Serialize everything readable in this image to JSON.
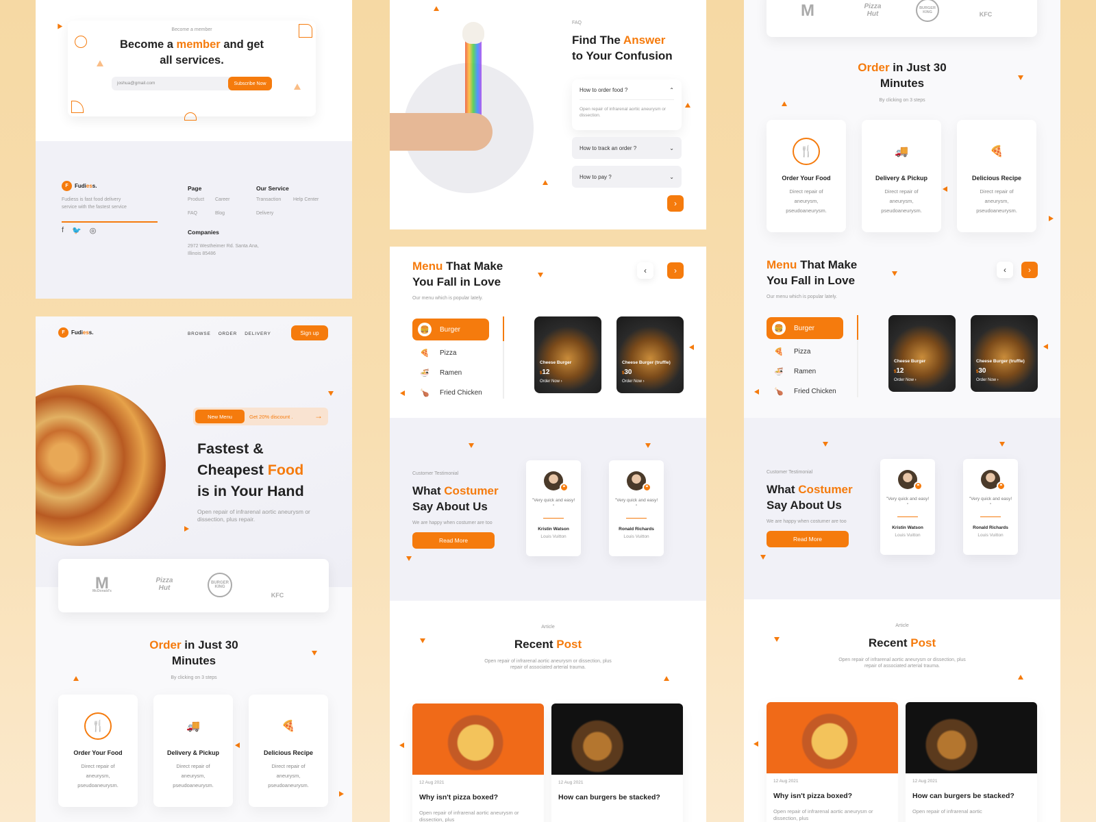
{
  "brand": {
    "prefix": "Fudi",
    "accent": "es",
    "suffix": "s.",
    "letter": "F"
  },
  "nav": {
    "browse": "BROWSE",
    "order": "ORDER",
    "delivery": "DELIVERY",
    "signup": "Sign up"
  },
  "member": {
    "eyebrow": "Become a member",
    "title_a": "Become a ",
    "title_accent": "member",
    "title_b": " and get",
    "title_c": "all services.",
    "email_value": "joshua@gmail.com",
    "subscribe": "Subscribe Now"
  },
  "footer": {
    "desc": "Fudiess is fast food delivery service with the fastest service",
    "page_h": "Page",
    "page_items": [
      "Product",
      "Career",
      "FAQ",
      "Blog"
    ],
    "service_h": "Our Service",
    "service_items": [
      "Transaction",
      "Help Center",
      "Delivery"
    ],
    "companies_h": "Companies",
    "address": "2972 Westheimer Rd. Santa Ana, Illinois 85486"
  },
  "hero": {
    "badge": "New Menu",
    "discount": "Get 20% discount .",
    "line1": "Fastest &",
    "line2a": "Cheapest ",
    "line2b": "Food",
    "line3": "is in Your Hand",
    "desc": "Open repair of infrarenal aortic aneurysm or dissection, plus repair."
  },
  "partners": [
    "McDonald's",
    "Pizza Hut",
    "BURGER KING",
    "KFC"
  ],
  "order": {
    "accent": "Order",
    "title": " in Just 30",
    "title2": "Minutes",
    "sub": "By clicking on 3 steps",
    "steps": [
      {
        "title": "Order Your Food",
        "desc": "Direct repair of aneurysm, pseudoaneurysm.",
        "icon": "fork-knife-icon"
      },
      {
        "title": "Delivery & Pickup",
        "desc": "Direct repair of aneurysm, pseudoaneurysm.",
        "icon": "truck-icon"
      },
      {
        "title": "Delicious Recipe",
        "desc": "Direct repair of aneurysm, pseudoaneurysm.",
        "icon": "pizza-icon"
      }
    ]
  },
  "faq": {
    "eyebrow": "FAQ",
    "title_a": "Find The ",
    "title_accent": "Answer",
    "title_b": "to Your Confusion",
    "items": [
      {
        "q": "How to order food ?",
        "a": "Open repair of infrarenal aortic aneurysm or dissection."
      },
      {
        "q": "How to track an order ?"
      },
      {
        "q": "How to pay ?"
      }
    ]
  },
  "menu": {
    "accent": "Menu",
    "title": " That Make",
    "title2": "You Fall in Love",
    "sub": "Our menu which is popular lately.",
    "items": [
      "Burger",
      "Pizza",
      "Ramen",
      "Fried Chicken"
    ],
    "foods": [
      {
        "name": "Cheese Burger",
        "price": "12",
        "cta": "Order Now"
      },
      {
        "name": "Cheese Burger (truffle)",
        "price": "30",
        "cta": "Order Now"
      }
    ],
    "currency": "$"
  },
  "testimonial": {
    "eyebrow": "Customer Testimonial",
    "title_a": "What ",
    "title_accent": "Costumer",
    "title_b": "Say About Us",
    "desc": "We are happy when costumer are too",
    "cta": "Read More",
    "cards": [
      {
        "quote": "\"Very quick and easy! \"",
        "name": "Kristin Watson",
        "company": "Louis Vuitton"
      },
      {
        "quote": "\"Very quick and easy! \"",
        "name": "Ronald Richards",
        "company": "Louis Vuitton"
      }
    ]
  },
  "posts": {
    "eyebrow": "Article",
    "title_a": "Recent ",
    "title_accent": "Post",
    "desc": "Open repair of infrarenal aortic aneurysm or dissection, plus repair of associated arterial trauma.",
    "items": [
      {
        "date": "12 Aug 2021",
        "title": "Why isn't pizza boxed?",
        "desc": "Open repair of infrarenal aortic aneurysm or dissection, plus"
      },
      {
        "date": "12 Aug 2021",
        "title": "How can burgers be stacked?",
        "desc": "Open repair of infrarenal aortic"
      }
    ]
  },
  "colors": {
    "accent": "#f57b0d",
    "bg": "#f6d9a4",
    "lavender": "#f1f1f7"
  }
}
